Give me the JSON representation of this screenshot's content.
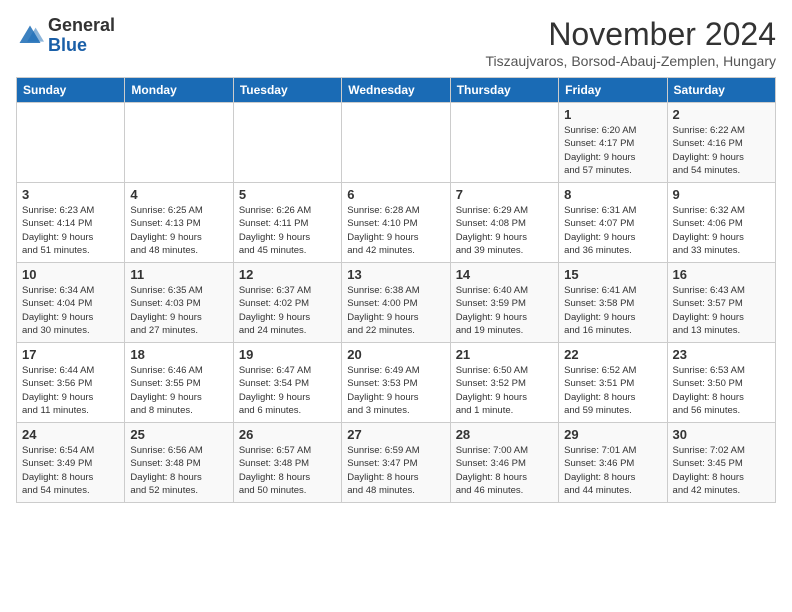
{
  "logo": {
    "general": "General",
    "blue": "Blue"
  },
  "title": "November 2024",
  "subtitle": "Tiszaujvaros, Borsod-Abauj-Zemplen, Hungary",
  "headers": [
    "Sunday",
    "Monday",
    "Tuesday",
    "Wednesday",
    "Thursday",
    "Friday",
    "Saturday"
  ],
  "weeks": [
    [
      {
        "day": "",
        "info": ""
      },
      {
        "day": "",
        "info": ""
      },
      {
        "day": "",
        "info": ""
      },
      {
        "day": "",
        "info": ""
      },
      {
        "day": "",
        "info": ""
      },
      {
        "day": "1",
        "info": "Sunrise: 6:20 AM\nSunset: 4:17 PM\nDaylight: 9 hours\nand 57 minutes."
      },
      {
        "day": "2",
        "info": "Sunrise: 6:22 AM\nSunset: 4:16 PM\nDaylight: 9 hours\nand 54 minutes."
      }
    ],
    [
      {
        "day": "3",
        "info": "Sunrise: 6:23 AM\nSunset: 4:14 PM\nDaylight: 9 hours\nand 51 minutes."
      },
      {
        "day": "4",
        "info": "Sunrise: 6:25 AM\nSunset: 4:13 PM\nDaylight: 9 hours\nand 48 minutes."
      },
      {
        "day": "5",
        "info": "Sunrise: 6:26 AM\nSunset: 4:11 PM\nDaylight: 9 hours\nand 45 minutes."
      },
      {
        "day": "6",
        "info": "Sunrise: 6:28 AM\nSunset: 4:10 PM\nDaylight: 9 hours\nand 42 minutes."
      },
      {
        "day": "7",
        "info": "Sunrise: 6:29 AM\nSunset: 4:08 PM\nDaylight: 9 hours\nand 39 minutes."
      },
      {
        "day": "8",
        "info": "Sunrise: 6:31 AM\nSunset: 4:07 PM\nDaylight: 9 hours\nand 36 minutes."
      },
      {
        "day": "9",
        "info": "Sunrise: 6:32 AM\nSunset: 4:06 PM\nDaylight: 9 hours\nand 33 minutes."
      }
    ],
    [
      {
        "day": "10",
        "info": "Sunrise: 6:34 AM\nSunset: 4:04 PM\nDaylight: 9 hours\nand 30 minutes."
      },
      {
        "day": "11",
        "info": "Sunrise: 6:35 AM\nSunset: 4:03 PM\nDaylight: 9 hours\nand 27 minutes."
      },
      {
        "day": "12",
        "info": "Sunrise: 6:37 AM\nSunset: 4:02 PM\nDaylight: 9 hours\nand 24 minutes."
      },
      {
        "day": "13",
        "info": "Sunrise: 6:38 AM\nSunset: 4:00 PM\nDaylight: 9 hours\nand 22 minutes."
      },
      {
        "day": "14",
        "info": "Sunrise: 6:40 AM\nSunset: 3:59 PM\nDaylight: 9 hours\nand 19 minutes."
      },
      {
        "day": "15",
        "info": "Sunrise: 6:41 AM\nSunset: 3:58 PM\nDaylight: 9 hours\nand 16 minutes."
      },
      {
        "day": "16",
        "info": "Sunrise: 6:43 AM\nSunset: 3:57 PM\nDaylight: 9 hours\nand 13 minutes."
      }
    ],
    [
      {
        "day": "17",
        "info": "Sunrise: 6:44 AM\nSunset: 3:56 PM\nDaylight: 9 hours\nand 11 minutes."
      },
      {
        "day": "18",
        "info": "Sunrise: 6:46 AM\nSunset: 3:55 PM\nDaylight: 9 hours\nand 8 minutes."
      },
      {
        "day": "19",
        "info": "Sunrise: 6:47 AM\nSunset: 3:54 PM\nDaylight: 9 hours\nand 6 minutes."
      },
      {
        "day": "20",
        "info": "Sunrise: 6:49 AM\nSunset: 3:53 PM\nDaylight: 9 hours\nand 3 minutes."
      },
      {
        "day": "21",
        "info": "Sunrise: 6:50 AM\nSunset: 3:52 PM\nDaylight: 9 hours\nand 1 minute."
      },
      {
        "day": "22",
        "info": "Sunrise: 6:52 AM\nSunset: 3:51 PM\nDaylight: 8 hours\nand 59 minutes."
      },
      {
        "day": "23",
        "info": "Sunrise: 6:53 AM\nSunset: 3:50 PM\nDaylight: 8 hours\nand 56 minutes."
      }
    ],
    [
      {
        "day": "24",
        "info": "Sunrise: 6:54 AM\nSunset: 3:49 PM\nDaylight: 8 hours\nand 54 minutes."
      },
      {
        "day": "25",
        "info": "Sunrise: 6:56 AM\nSunset: 3:48 PM\nDaylight: 8 hours\nand 52 minutes."
      },
      {
        "day": "26",
        "info": "Sunrise: 6:57 AM\nSunset: 3:48 PM\nDaylight: 8 hours\nand 50 minutes."
      },
      {
        "day": "27",
        "info": "Sunrise: 6:59 AM\nSunset: 3:47 PM\nDaylight: 8 hours\nand 48 minutes."
      },
      {
        "day": "28",
        "info": "Sunrise: 7:00 AM\nSunset: 3:46 PM\nDaylight: 8 hours\nand 46 minutes."
      },
      {
        "day": "29",
        "info": "Sunrise: 7:01 AM\nSunset: 3:46 PM\nDaylight: 8 hours\nand 44 minutes."
      },
      {
        "day": "30",
        "info": "Sunrise: 7:02 AM\nSunset: 3:45 PM\nDaylight: 8 hours\nand 42 minutes."
      }
    ]
  ]
}
